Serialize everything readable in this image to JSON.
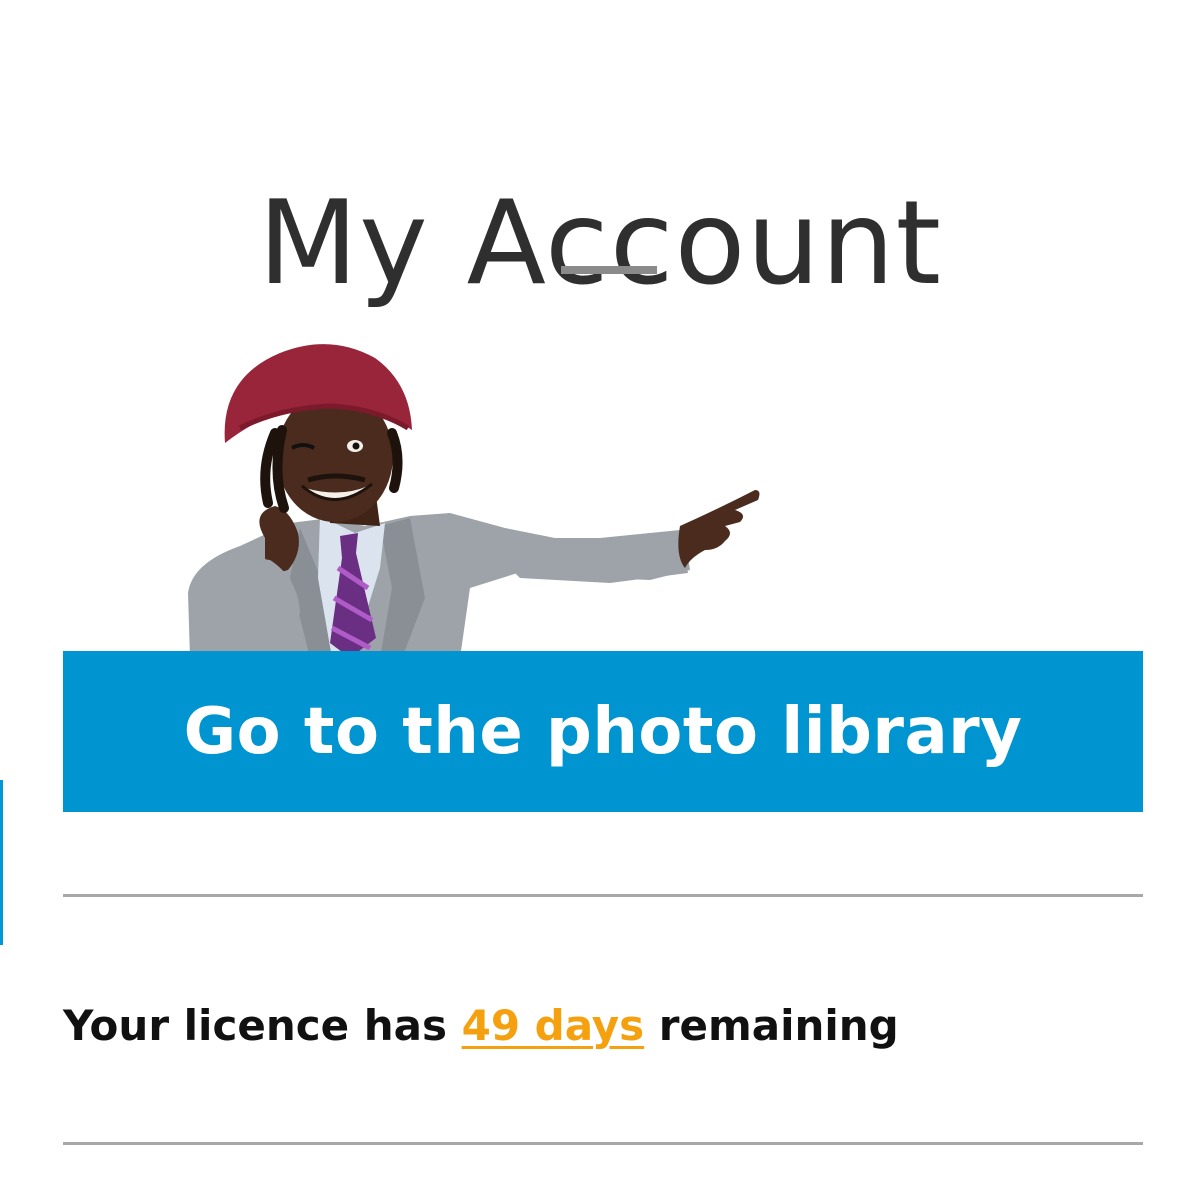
{
  "header": {
    "title": "My Account"
  },
  "hero": {
    "image_alt": "Smiling man in a red knitted hat and grey suit pointing to the right"
  },
  "cta": {
    "label": "Go to the photo library"
  },
  "licence": {
    "prefix": "Your licence has ",
    "days": "49 days",
    "suffix": " remaining"
  },
  "colors": {
    "accent_blue": "#0095d0",
    "days_orange": "#f5a10f",
    "title_text": "#2f2f2f",
    "divider": "#a8a8a8"
  }
}
